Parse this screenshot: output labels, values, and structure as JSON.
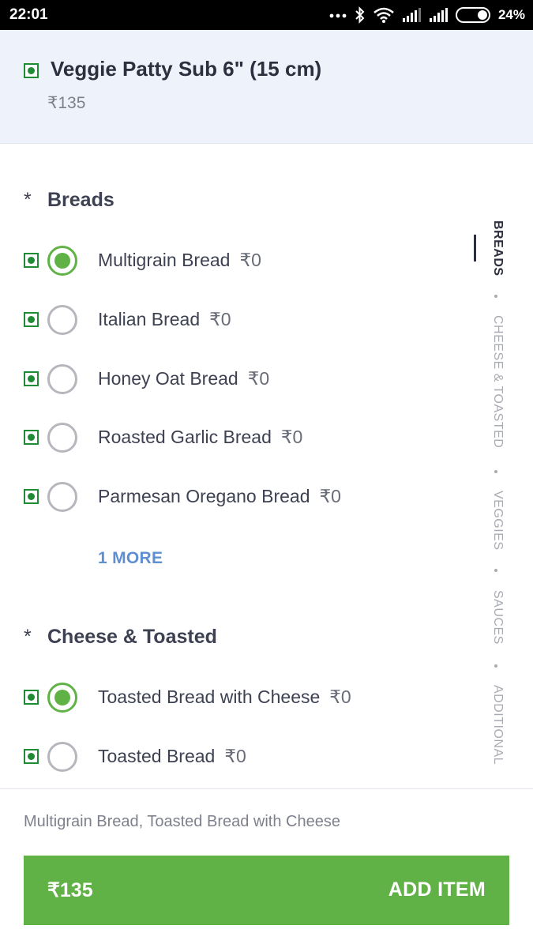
{
  "status_bar": {
    "time": "22:01",
    "battery": "24%"
  },
  "item": {
    "name": "Veggie Patty Sub 6\" (15 cm)",
    "price": "₹135"
  },
  "sections": [
    {
      "title": "Breads",
      "required_mark": "*",
      "options": [
        {
          "label": "Multigrain Bread",
          "price": "₹0",
          "selected": true
        },
        {
          "label": "Italian Bread",
          "price": "₹0",
          "selected": false
        },
        {
          "label": "Honey Oat Bread",
          "price": "₹0",
          "selected": false
        },
        {
          "label": "Roasted Garlic Bread",
          "price": "₹0",
          "selected": false
        },
        {
          "label": "Parmesan Oregano Bread",
          "price": "₹0",
          "selected": false
        }
      ],
      "more_label": "1 MORE"
    },
    {
      "title": "Cheese & Toasted",
      "required_mark": "*",
      "options": [
        {
          "label": "Toasted Bread with Cheese",
          "price": "₹0",
          "selected": true
        },
        {
          "label": "Toasted Bread",
          "price": "₹0",
          "selected": false
        }
      ]
    }
  ],
  "side_nav": [
    "BREADS",
    "CHEESE & TOASTED",
    "VEGGIES",
    "SAUCES",
    "ADDITIONAL"
  ],
  "footer": {
    "summary": "Multigrain Bread, Toasted Bread with Cheese",
    "button_price": "₹135",
    "button_label": "ADD ITEM"
  },
  "colors": {
    "veg_green": "#1e8c34",
    "accent_green": "#60b246",
    "link_blue": "#5f8fd0",
    "header_bg": "#eef2fa"
  }
}
